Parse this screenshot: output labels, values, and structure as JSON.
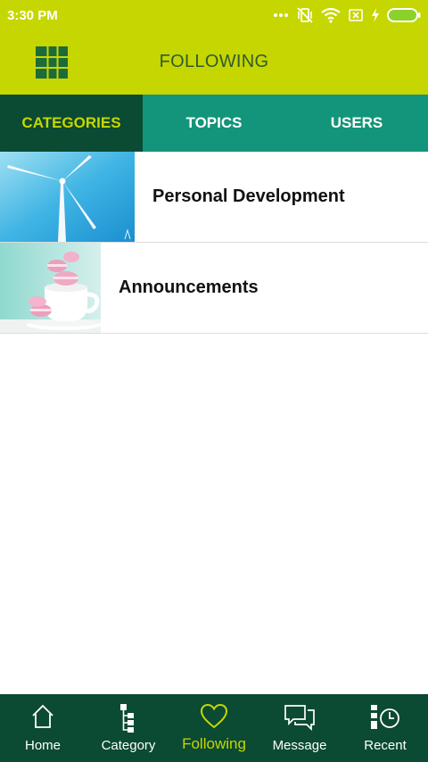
{
  "status_bar": {
    "time": "3:30 PM",
    "icons": [
      "more-dots-icon",
      "vibrate-off-icon",
      "wifi-icon",
      "sim-blocked-icon",
      "charging-icon",
      "battery-icon"
    ]
  },
  "header": {
    "title": "FOLLOWING",
    "menu_icon": "grid-menu-icon"
  },
  "tabs": [
    {
      "label": "CATEGORIES",
      "active": true
    },
    {
      "label": "TOPICS",
      "active": false
    },
    {
      "label": "USERS",
      "active": false
    }
  ],
  "categories": [
    {
      "title": "Personal Development",
      "image": "wind-turbine"
    },
    {
      "title": "Announcements",
      "image": "pink-macarons-cup"
    }
  ],
  "bottom_nav": [
    {
      "label": "Home",
      "icon": "home-icon",
      "active": false
    },
    {
      "label": "Category",
      "icon": "tree-icon",
      "active": false
    },
    {
      "label": "Following",
      "icon": "heart-icon",
      "active": true
    },
    {
      "label": "Message",
      "icon": "chat-bubbles-icon",
      "active": false
    },
    {
      "label": "Recent",
      "icon": "recent-clock-icon",
      "active": false
    }
  ],
  "colors": {
    "lime": "#c6d600",
    "teal": "#12957a",
    "dark_green": "#0b4a33",
    "title_green": "#2e5c30"
  }
}
